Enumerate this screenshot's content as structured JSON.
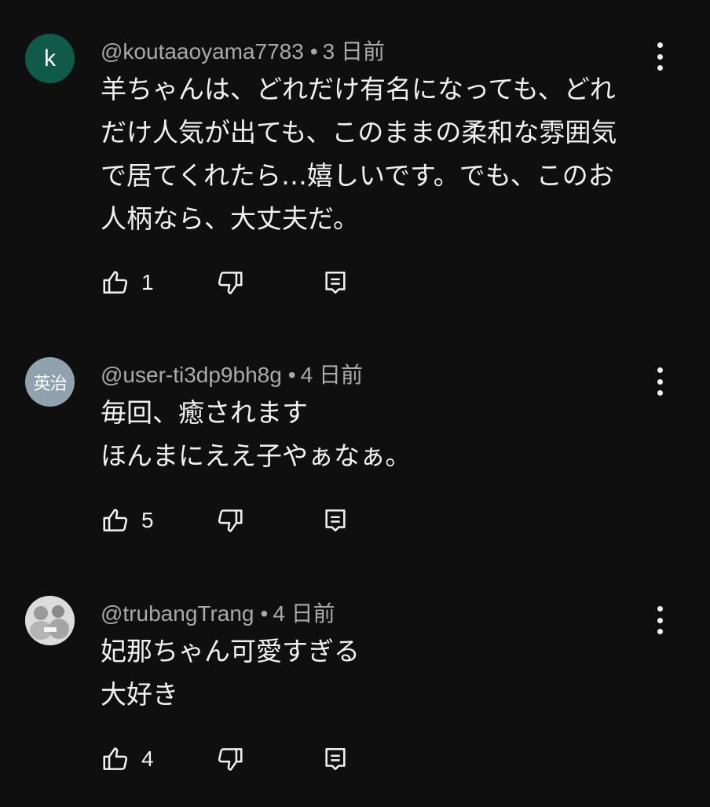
{
  "comments": [
    {
      "avatar_text": "k",
      "author": "@koutaaoyama7783",
      "time": "3 日前",
      "lines": [
        "羊ちゃんは、どれだけ有名になっても、どれ",
        "だけ人気が出ても、このままの柔和な雰囲気",
        "で居てくれたら…嬉しいです。でも、このお",
        "人柄なら、大丈夫だ。"
      ],
      "likes": "1"
    },
    {
      "avatar_text": "英治",
      "author": "@user-ti3dp9bh8g",
      "time": "4 日前",
      "lines": [
        "毎回、癒されます",
        "ほんまにええ子やぁなぁ。"
      ],
      "likes": "5"
    },
    {
      "avatar_text": "",
      "author": "@trubangTrang",
      "time": "4 日前",
      "lines": [
        "妃那ちゃん可愛すぎる",
        "大好き"
      ],
      "likes": "4"
    }
  ],
  "icons": {
    "like": "thumbs-up-icon",
    "dislike": "thumbs-down-icon",
    "reply": "reply-icon",
    "more": "more-vert-icon"
  },
  "colors": {
    "background": "#0f0f0f",
    "text": "#f1f1f1",
    "meta": "#aaaaaa",
    "avatar_k": "#0f5a48",
    "avatar_jp": "#8fa2ad"
  }
}
